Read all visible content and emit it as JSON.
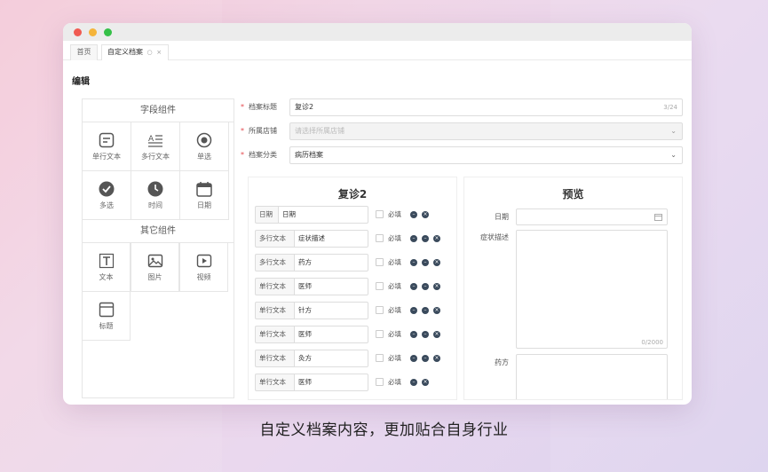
{
  "tabs": {
    "home": "首页",
    "active": "自定义档案",
    "close": "×",
    "refresh": "○"
  },
  "page_title": "编辑",
  "palette": {
    "field_section": "字段组件",
    "field_items": [
      {
        "label": "单行文本",
        "icon": "single-line-text-icon"
      },
      {
        "label": "多行文本",
        "icon": "multi-line-text-icon"
      },
      {
        "label": "单选",
        "icon": "radio-icon"
      },
      {
        "label": "多选",
        "icon": "checkbox-icon"
      },
      {
        "label": "时间",
        "icon": "clock-icon"
      },
      {
        "label": "日期",
        "icon": "calendar-icon"
      }
    ],
    "other_section": "其它组件",
    "other_items": [
      {
        "label": "文本",
        "icon": "text-icon"
      },
      {
        "label": "图片",
        "icon": "image-icon"
      },
      {
        "label": "视频",
        "icon": "video-icon"
      },
      {
        "label": "标题",
        "icon": "title-icon"
      }
    ]
  },
  "form": {
    "title_label": "档案标题",
    "title_value": "复诊2",
    "title_count": "3/24",
    "store_label": "所属店铺",
    "store_placeholder": "请选择所属店铺",
    "category_label": "档案分类",
    "category_value": "病历档案",
    "required_mark": "*",
    "chevron": "⌄"
  },
  "editor": {
    "title": "复诊2",
    "required_text": "必填",
    "fields": [
      {
        "type": "日期",
        "name": "日期",
        "buttons": 2
      },
      {
        "type": "多行文本",
        "name": "症状描述",
        "buttons": 3
      },
      {
        "type": "多行文本",
        "name": "药方",
        "buttons": 3
      },
      {
        "type": "单行文本",
        "name": "医师",
        "buttons": 3
      },
      {
        "type": "单行文本",
        "name": "针方",
        "buttons": 3
      },
      {
        "type": "单行文本",
        "name": "医师",
        "buttons": 3
      },
      {
        "type": "单行文本",
        "name": "灸方",
        "buttons": 3
      },
      {
        "type": "单行文本",
        "name": "医师",
        "buttons": 2
      }
    ]
  },
  "preview": {
    "title": "预览",
    "date_label": "日期",
    "symptom_label": "症状描述",
    "symptom_count": "0/2000",
    "prescription_label": "药方"
  },
  "caption": "自定义档案内容，更加贴合自身行业"
}
